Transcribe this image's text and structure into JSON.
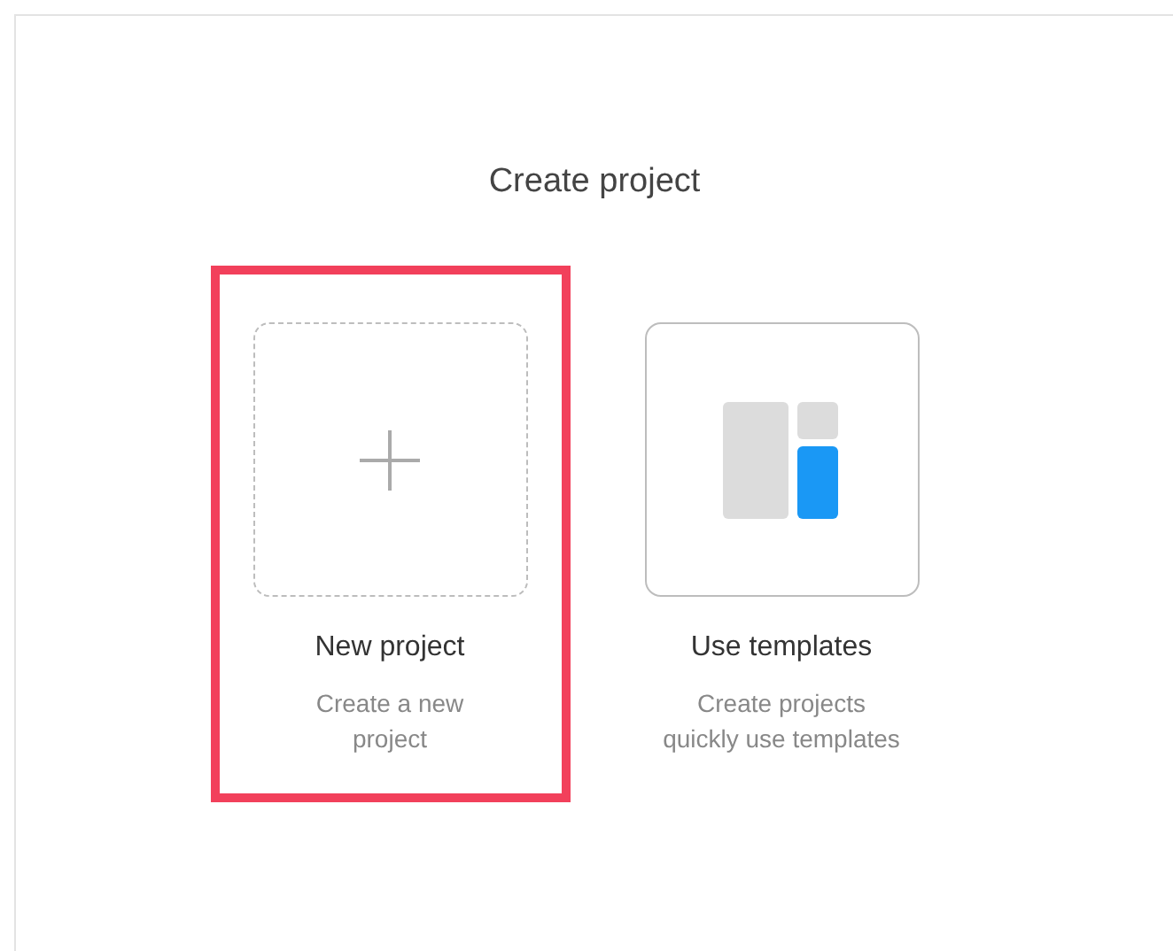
{
  "title": "Create project",
  "options": [
    {
      "kind": "blank",
      "label": "New project",
      "description_lines": [
        "Create a new",
        "project"
      ],
      "highlighted": true
    },
    {
      "kind": "template",
      "label": "Use templates",
      "description_lines": [
        "Create projects",
        "quickly use templates"
      ],
      "highlighted": false
    }
  ]
}
